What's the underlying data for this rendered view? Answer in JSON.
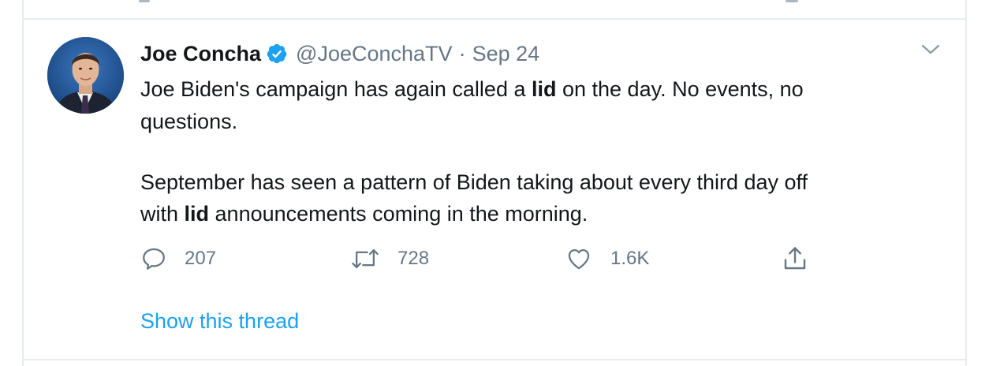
{
  "tweet": {
    "author_name": "Joe Concha",
    "handle": "@JoeConchaTV",
    "separator": "·",
    "date": "Sep 24",
    "lines": [
      {
        "before": "Joe Biden's campaign has again called a ",
        "bold": "lid",
        "after": " on the day. No events, no"
      },
      {
        "text": "questions."
      },
      {
        "text": "September has seen a pattern of Biden taking about every third day off"
      },
      {
        "before": "with ",
        "bold": "lid",
        "after": " announcements coming in the morning."
      }
    ],
    "actions": {
      "replies": "207",
      "retweets": "728",
      "likes": "1.6K"
    },
    "show_thread": "Show this thread"
  },
  "colors": {
    "accent": "#1da1f2",
    "text": "#14171a",
    "muted": "#657786",
    "border": "#e6ecf0"
  },
  "icons": [
    "verified-badge-icon",
    "chevron-down-icon",
    "reply-icon",
    "retweet-icon",
    "like-icon",
    "share-icon"
  ]
}
